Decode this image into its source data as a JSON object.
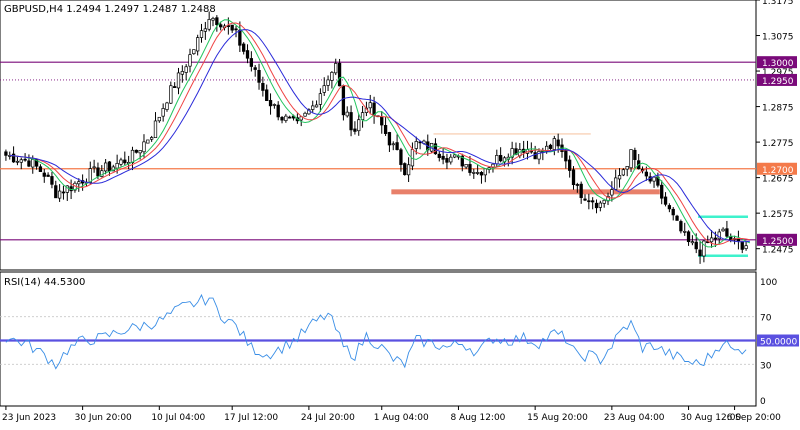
{
  "colors": {
    "background": "#ffffff",
    "frame": "#000000",
    "candle_up": "#000000",
    "candle_down": "#000000",
    "ma_fast": "#22c55e",
    "ma_mid": "#ef4444",
    "ma_slow": "#2b2bd9",
    "level_purple": "#7a0a7a",
    "level_orange": "#f47a4a",
    "zone_cyan": "#3ef2cc",
    "channel_tan": "#f7c8a8",
    "rsi_line": "#3a8ee6",
    "rsi_level": "#5a50e0"
  },
  "chart_data": [
    {
      "type": "candlestick",
      "title": "GBPUSD,H4  1.2494 1.2497 1.2487 1.2488",
      "header": {
        "symbol": "GBPUSD,H4",
        "ohlc": "1.2494 1.2497 1.2487 1.2488"
      },
      "ylim": [
        1.2415,
        1.3175
      ],
      "y_ticks": [
        "1.3175",
        "1.3075",
        "1.2975",
        "1.2875",
        "1.2775",
        "1.2675",
        "1.2575",
        "1.2475"
      ],
      "x_ticks": [
        "23 Jun 2023",
        "30 Jun 20:00",
        "10 Jul 04:00",
        "17 Jul 12:00",
        "24 Jul 20:00",
        "1 Aug 04:00",
        "8 Aug 12:00",
        "15 Aug 20:00",
        "23 Aug 04:00",
        "30 Aug 12:00",
        "6 Sep 20:00"
      ],
      "close_anchors": [
        [
          0,
          1.2738
        ],
        [
          6,
          1.2722
        ],
        [
          10,
          1.2686
        ],
        [
          13,
          1.2633
        ],
        [
          17,
          1.265
        ],
        [
          22,
          1.2685
        ],
        [
          28,
          1.2708
        ],
        [
          33,
          1.2735
        ],
        [
          38,
          1.28
        ],
        [
          42,
          1.29
        ],
        [
          46,
          1.2975
        ],
        [
          50,
          1.306
        ],
        [
          53,
          1.313
        ],
        [
          56,
          1.3115
        ],
        [
          60,
          1.3075
        ],
        [
          64,
          1.299
        ],
        [
          68,
          1.29
        ],
        [
          72,
          1.2845
        ],
        [
          76,
          1.282
        ],
        [
          80,
          1.2875
        ],
        [
          84,
          1.296
        ],
        [
          86,
          1.299
        ],
        [
          88,
          1.286
        ],
        [
          91,
          1.281
        ],
        [
          94,
          1.2885
        ],
        [
          98,
          1.282
        ],
        [
          101,
          1.276
        ],
        [
          104,
          1.27
        ],
        [
          107,
          1.277
        ],
        [
          111,
          1.276
        ],
        [
          115,
          1.2735
        ],
        [
          119,
          1.272
        ],
        [
          123,
          1.269
        ],
        [
          127,
          1.272
        ],
        [
          131,
          1.275
        ],
        [
          135,
          1.276
        ],
        [
          139,
          1.274
        ],
        [
          143,
          1.277
        ],
        [
          146,
          1.273
        ],
        [
          149,
          1.264
        ],
        [
          152,
          1.262
        ],
        [
          155,
          1.26
        ],
        [
          158,
          1.264
        ],
        [
          161,
          1.27
        ],
        [
          163,
          1.274
        ],
        [
          166,
          1.268
        ],
        [
          169,
          1.266
        ],
        [
          172,
          1.26
        ],
        [
          175,
          1.254
        ],
        [
          178,
          1.249
        ],
        [
          181,
          1.247
        ],
        [
          184,
          1.25
        ],
        [
          187,
          1.252
        ],
        [
          190,
          1.249
        ],
        [
          193,
          1.2488
        ]
      ],
      "horizontal_levels": [
        {
          "label": "1.3000",
          "value": 1.3,
          "style": "solid",
          "color": "#7a0a7a"
        },
        {
          "label": "1.2950",
          "value": 1.295,
          "style": "dotted",
          "color": "#7a0a7a"
        },
        {
          "label": "1.2700",
          "value": 1.27,
          "style": "solid",
          "color": "#f47a4a"
        },
        {
          "label": "1.2500",
          "value": 1.25,
          "style": "solid",
          "color": "#7a0a7a"
        }
      ],
      "zones": [
        {
          "kind": "support-bar",
          "from_bar": 101,
          "to_bar": 170,
          "value": 1.2635,
          "color": "#e8806a"
        },
        {
          "kind": "channel-top",
          "from_bar": 112,
          "to_bar": 152,
          "value": 1.2798,
          "color": "#f7c8a8"
        },
        {
          "kind": "range-top",
          "from_bar": 181,
          "to_bar": 193,
          "value": 1.2565,
          "color": "#3ef2cc"
        },
        {
          "kind": "range-bottom",
          "from_bar": 181,
          "to_bar": 193,
          "value": 1.2455,
          "color": "#3ef2cc"
        }
      ],
      "moving_averages": [
        {
          "period": 5,
          "color": "#22c55e"
        },
        {
          "period": 8,
          "color": "#ef4444"
        },
        {
          "period": 13,
          "color": "#2b2bd9"
        }
      ],
      "bars_total": 194
    },
    {
      "type": "line",
      "title": "RSI(14) 44.5300",
      "indicator": "RSI(14)",
      "current_value": "44.5300",
      "ylim": [
        0,
        100
      ],
      "y_ticks": [
        "100",
        "70",
        "50.0000",
        "30",
        "0"
      ],
      "levels": [
        70,
        50,
        30
      ],
      "highlight_level": 50,
      "rsi_anchors": [
        [
          0,
          52
        ],
        [
          5,
          48
        ],
        [
          10,
          38
        ],
        [
          13,
          30
        ],
        [
          16,
          42
        ],
        [
          20,
          50
        ],
        [
          25,
          52
        ],
        [
          30,
          58
        ],
        [
          35,
          62
        ],
        [
          40,
          66
        ],
        [
          43,
          72
        ],
        [
          46,
          78
        ],
        [
          50,
          82
        ],
        [
          53,
          86
        ],
        [
          56,
          72
        ],
        [
          60,
          62
        ],
        [
          64,
          44
        ],
        [
          68,
          38
        ],
        [
          72,
          44
        ],
        [
          76,
          52
        ],
        [
          80,
          64
        ],
        [
          84,
          72
        ],
        [
          86,
          60
        ],
        [
          88,
          44
        ],
        [
          91,
          38
        ],
        [
          94,
          54
        ],
        [
          98,
          44
        ],
        [
          101,
          34
        ],
        [
          104,
          30
        ],
        [
          107,
          50
        ],
        [
          111,
          48
        ],
        [
          115,
          44
        ],
        [
          119,
          48
        ],
        [
          123,
          40
        ],
        [
          127,
          52
        ],
        [
          131,
          50
        ],
        [
          135,
          52
        ],
        [
          139,
          48
        ],
        [
          143,
          56
        ],
        [
          146,
          52
        ],
        [
          149,
          36
        ],
        [
          152,
          38
        ],
        [
          155,
          34
        ],
        [
          158,
          46
        ],
        [
          161,
          60
        ],
        [
          163,
          64
        ],
        [
          166,
          44
        ],
        [
          169,
          46
        ],
        [
          172,
          40
        ],
        [
          175,
          36
        ],
        [
          178,
          32
        ],
        [
          181,
          30
        ],
        [
          184,
          38
        ],
        [
          187,
          50
        ],
        [
          190,
          40
        ],
        [
          193,
          44.53
        ]
      ]
    }
  ]
}
